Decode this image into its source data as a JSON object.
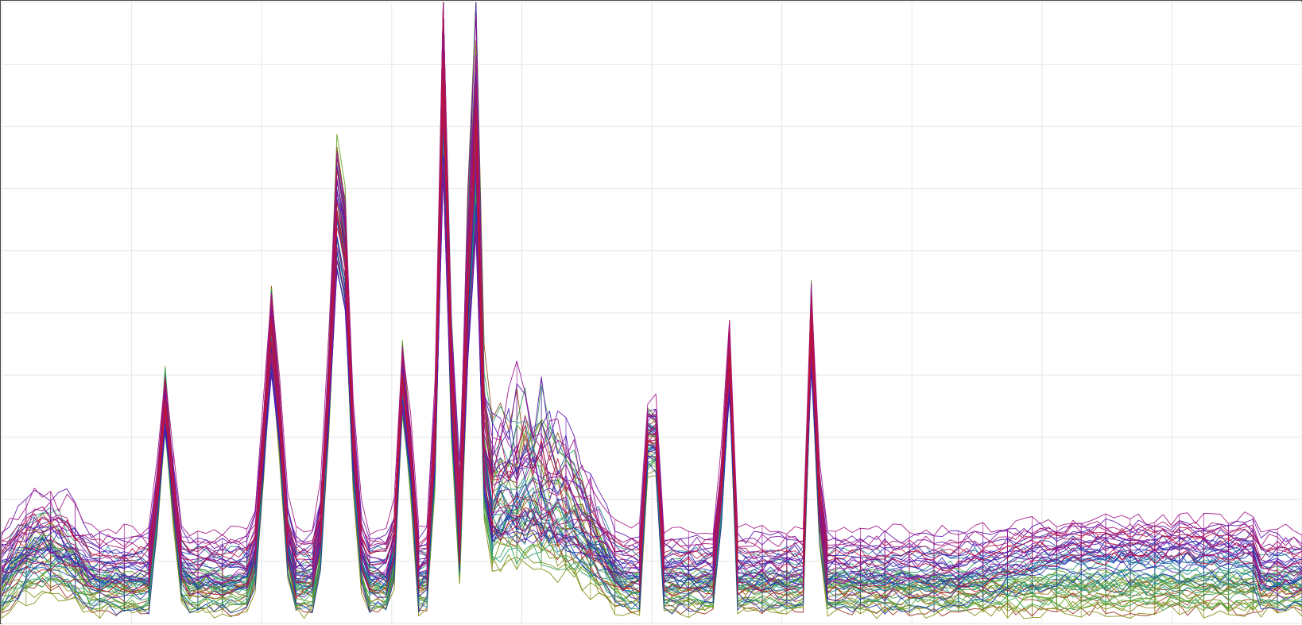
{
  "chart_data": {
    "type": "line",
    "title": "",
    "xlabel": "",
    "ylabel": "",
    "xlim": [
      0,
      100
    ],
    "ylim": [
      0,
      100
    ],
    "grid": true,
    "legend": "none",
    "x_ticks": [
      0,
      10,
      20,
      30,
      40,
      50,
      60,
      70,
      80,
      90,
      100
    ],
    "y_ticks": [
      0,
      10,
      20,
      30,
      40,
      50,
      60,
      70,
      80,
      90,
      100
    ],
    "series_count": 60,
    "x_samples": 160,
    "colormap": [
      "#9b1c1c",
      "#8a8a10",
      "#5aa51e",
      "#1f9e6a",
      "#1b78a8",
      "#1a2fb0",
      "#5a14b0",
      "#a0148c",
      "#c0142a"
    ],
    "features": {
      "bumps": [
        {
          "x0": 0.0,
          "x1": 7.6,
          "peak": 30.6
        },
        {
          "x0": 32.5,
          "x1": 49.0,
          "peak": 54.9
        }
      ],
      "spikes": [
        {
          "x": 12.6,
          "width": 0.5,
          "peak": 40.8
        },
        {
          "x": 20.8,
          "width": 0.6,
          "peak": 55.0
        },
        {
          "x": 26.0,
          "width": 0.7,
          "peak": 81.4
        },
        {
          "x": 31.0,
          "width": 0.4,
          "peak": 49.7
        },
        {
          "x": 34.0,
          "width": 0.4,
          "peak": 100.0
        },
        {
          "x": 36.3,
          "width": 0.4,
          "peak": 90.7
        },
        {
          "x": 50.0,
          "width": 0.3,
          "peak": 53.1
        },
        {
          "x": 55.8,
          "width": 0.3,
          "peak": 57.8
        },
        {
          "x": 62.4,
          "width": 0.3,
          "peak": 60.9
        }
      ],
      "plateaus": [
        {
          "x0": 73.0,
          "x1": 96.8,
          "level": 20.3
        }
      ],
      "baseline_band": [
        0.5,
        17.5
      ]
    }
  }
}
